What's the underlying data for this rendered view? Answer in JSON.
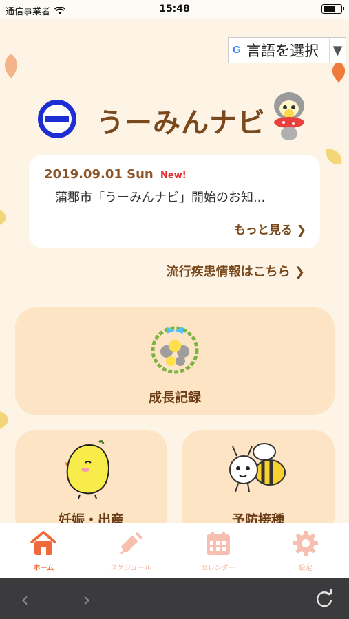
{
  "status": {
    "carrier": "通信事業者",
    "time": "15:48"
  },
  "translate": {
    "label": "言語を選択"
  },
  "app": {
    "title": "うーみんナビ"
  },
  "news": {
    "date": "2019.09.01 Sun",
    "badge": "New!",
    "text": "蒲郡市「うーみんナビ」開始のお知...",
    "more": "もっと見る"
  },
  "disease_link": "流行疾患情報はこちら",
  "tiles": {
    "growth": "成長記録",
    "pregnancy": "妊娠・出産",
    "vaccination": "予防接種"
  },
  "tabs": [
    {
      "label": "ホーム",
      "icon": "home-icon",
      "active": true
    },
    {
      "label": "スケジュール",
      "icon": "syringe-icon",
      "active": false
    },
    {
      "label": "カレンダー",
      "icon": "calendar-icon",
      "active": false
    },
    {
      "label": "設定",
      "icon": "gear-icon",
      "active": false
    }
  ],
  "colors": {
    "accent": "#ef6a3a",
    "tile": "#fde4c4",
    "brown": "#7a4a1e",
    "logo_blue": "#1d2fd4"
  }
}
